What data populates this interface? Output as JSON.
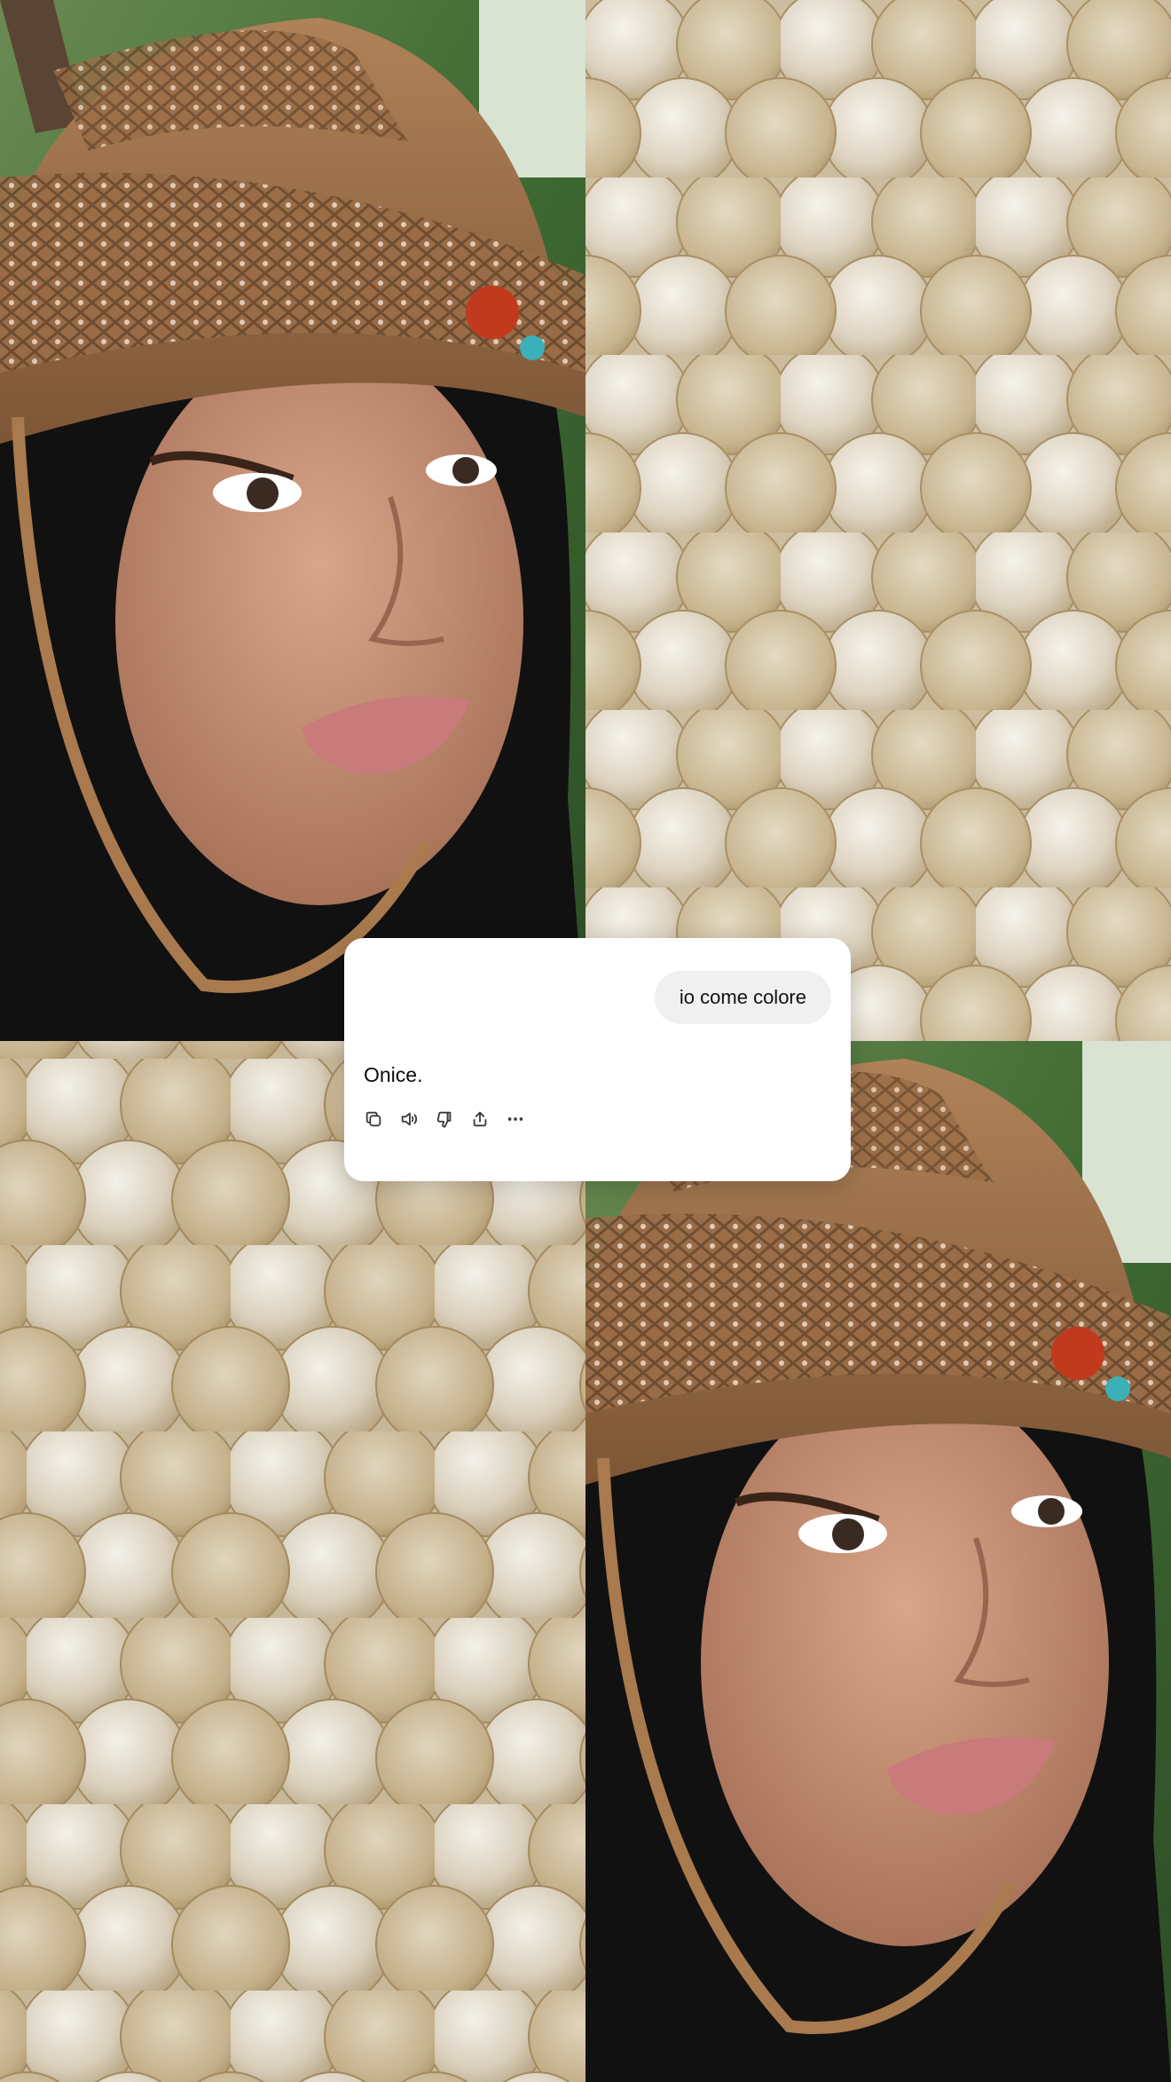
{
  "chat": {
    "user_message": "io come colore",
    "assistant_reply": "Onice.",
    "actions": [
      {
        "icon": "copy-icon",
        "label": "Copy"
      },
      {
        "icon": "speaker-icon",
        "label": "Read aloud"
      },
      {
        "icon": "thumbs-down-icon",
        "label": "Bad response"
      },
      {
        "icon": "share-icon",
        "label": "Share"
      },
      {
        "icon": "more-icon",
        "label": "More"
      }
    ]
  },
  "colors": {
    "card_background": "#ffffff",
    "bubble_background": "#f0f0f0",
    "text": "#0d0d0d",
    "icon": "#3a3a3a",
    "shell_light": "#e9e2d3",
    "shell_dark": "#c9b896",
    "hat": "#9a6d47",
    "skin": "#c89a80",
    "hair": "#111111",
    "foliage": "#3f6b33"
  }
}
